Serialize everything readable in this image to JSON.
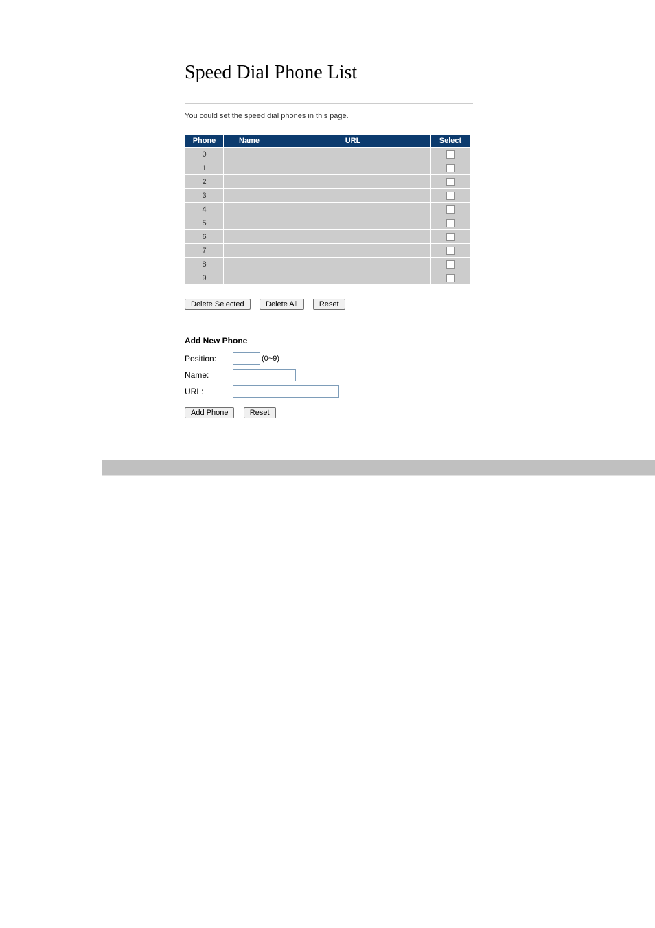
{
  "header": {
    "title": "Speed Dial Phone List",
    "description": "You could set the speed dial phones in this page."
  },
  "table": {
    "headers": {
      "phone": "Phone",
      "name": "Name",
      "url": "URL",
      "select": "Select"
    },
    "rows": [
      {
        "phone": "0",
        "name": "",
        "url": ""
      },
      {
        "phone": "1",
        "name": "",
        "url": ""
      },
      {
        "phone": "2",
        "name": "",
        "url": ""
      },
      {
        "phone": "3",
        "name": "",
        "url": ""
      },
      {
        "phone": "4",
        "name": "",
        "url": ""
      },
      {
        "phone": "5",
        "name": "",
        "url": ""
      },
      {
        "phone": "6",
        "name": "",
        "url": ""
      },
      {
        "phone": "7",
        "name": "",
        "url": ""
      },
      {
        "phone": "8",
        "name": "",
        "url": ""
      },
      {
        "phone": "9",
        "name": "",
        "url": ""
      }
    ]
  },
  "buttons": {
    "delete_selected": "Delete Selected",
    "delete_all": "Delete All",
    "reset": "Reset",
    "add_phone": "Add Phone",
    "reset2": "Reset"
  },
  "form": {
    "heading": "Add New Phone",
    "position_label": "Position:",
    "position_hint": "(0~9)",
    "name_label": "Name:",
    "url_label": "URL:",
    "position_value": "",
    "name_value": "",
    "url_value": ""
  }
}
